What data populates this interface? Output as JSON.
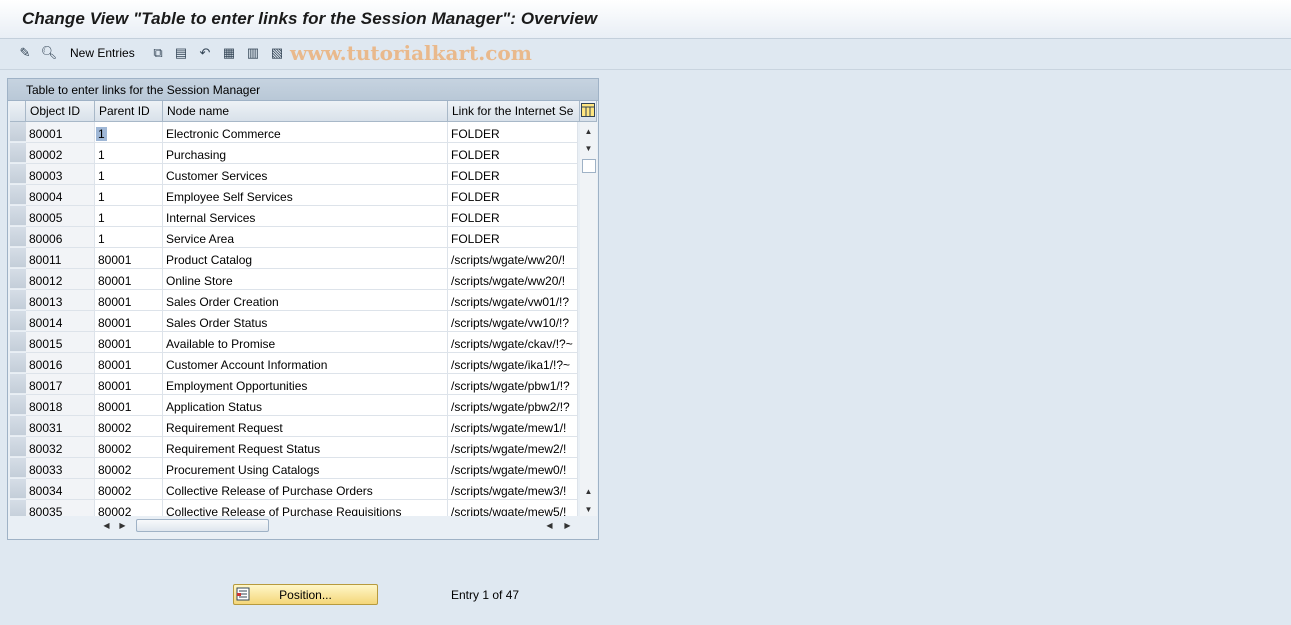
{
  "window": {
    "title": "Change View \"Table to enter links for the Session Manager\": Overview"
  },
  "toolbar": {
    "new_entries_label": "New Entries",
    "icons": [
      "display-change-icon",
      "find-icon",
      "copy-icon",
      "delete-icon",
      "undo-icon",
      "select-all-icon",
      "select-block-icon",
      "deselect-all-icon"
    ],
    "watermark": "www.tutorialkart.com"
  },
  "table": {
    "title": "Table to enter links for the Session Manager",
    "columns": [
      "Object ID",
      "Parent ID",
      "Node name",
      "Link for the Internet Se"
    ],
    "rows": [
      [
        "80001",
        "1",
        "Electronic Commerce",
        "FOLDER"
      ],
      [
        "80002",
        "1",
        "Purchasing",
        "FOLDER"
      ],
      [
        "80003",
        "1",
        "Customer Services",
        "FOLDER"
      ],
      [
        "80004",
        "1",
        "Employee Self Services",
        "FOLDER"
      ],
      [
        "80005",
        "1",
        "Internal Services",
        "FOLDER"
      ],
      [
        "80006",
        "1",
        "Service Area",
        "FOLDER"
      ],
      [
        "80011",
        "80001",
        "Product Catalog",
        "/scripts/wgate/ww20/!"
      ],
      [
        "80012",
        "80001",
        "Online Store",
        "/scripts/wgate/ww20/!"
      ],
      [
        "80013",
        "80001",
        "Sales Order Creation",
        "/scripts/wgate/vw01/!?"
      ],
      [
        "80014",
        "80001",
        "Sales Order Status",
        "/scripts/wgate/vw10/!?"
      ],
      [
        "80015",
        "80001",
        "Available to Promise",
        "/scripts/wgate/ckav/!?~"
      ],
      [
        "80016",
        "80001",
        "Customer Account Information",
        "/scripts/wgate/ika1/!?~"
      ],
      [
        "80017",
        "80001",
        "Employment Opportunities",
        "/scripts/wgate/pbw1/!?"
      ],
      [
        "80018",
        "80001",
        "Application Status",
        "/scripts/wgate/pbw2/!?"
      ],
      [
        "80031",
        "80002",
        "Requirement Request",
        "/scripts/wgate/mew1/!"
      ],
      [
        "80032",
        "80002",
        "Requirement Request Status",
        "/scripts/wgate/mew2/!"
      ],
      [
        "80033",
        "80002",
        "Procurement Using Catalogs",
        "/scripts/wgate/mew0/!"
      ],
      [
        "80034",
        "80002",
        "Collective Release of Purchase Orders",
        "/scripts/wgate/mew3/!"
      ],
      [
        "80035",
        "80002",
        "Collective Release of Purchase Requisitions",
        "/scripts/wgate/mew5/!"
      ]
    ]
  },
  "footer": {
    "position_label": "Position...",
    "entry_status": "Entry 1 of 47"
  }
}
